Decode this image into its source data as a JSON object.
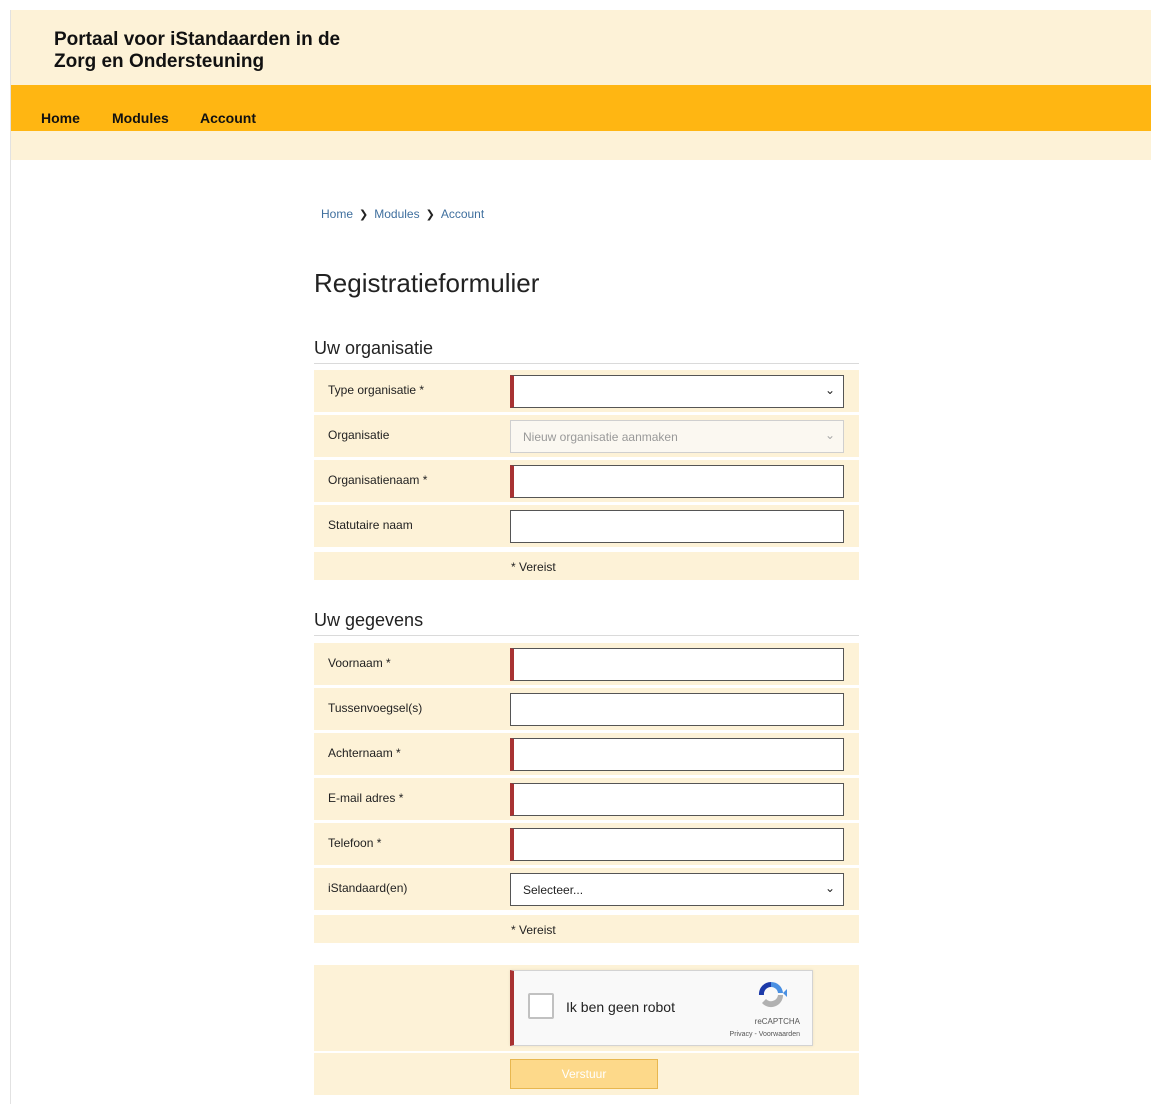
{
  "site": {
    "title_line1": "Portaal voor iStandaarden in de",
    "title_line2": "Zorg en Ondersteuning"
  },
  "nav": {
    "items": [
      "Home",
      "Modules",
      "Account"
    ]
  },
  "breadcrumb": [
    "Home",
    "Modules",
    "Account"
  ],
  "page": {
    "title": "Registratieformulier"
  },
  "organisation": {
    "heading": "Uw organisatie",
    "type_label": "Type organisatie *",
    "type_value": "",
    "org_label": "Organisatie",
    "org_value": "Nieuw organisatie aanmaken",
    "name_label": "Organisatienaam *",
    "statutory_label": "Statutaire naam",
    "required_note": "* Vereist"
  },
  "personal": {
    "heading": "Uw gegevens",
    "firstname_label": "Voornaam *",
    "infix_label": "Tussenvoegsel(s)",
    "lastname_label": "Achternaam *",
    "email_label": "E-mail adres *",
    "phone_label": "Telefoon *",
    "standards_label": "iStandaard(en)",
    "standards_value": "Selecteer...",
    "required_note": "* Vereist"
  },
  "captcha": {
    "label": "Ik ben geen robot",
    "brand": "reCAPTCHA",
    "privacy": "Privacy",
    "terms": "Voorwaarden"
  },
  "submit_label": "Verstuur",
  "colors": {
    "header_bg": "#fdf2d7",
    "nav_bg": "#ffb612",
    "required_marker": "#a83232",
    "link": "#3f6f9e"
  }
}
